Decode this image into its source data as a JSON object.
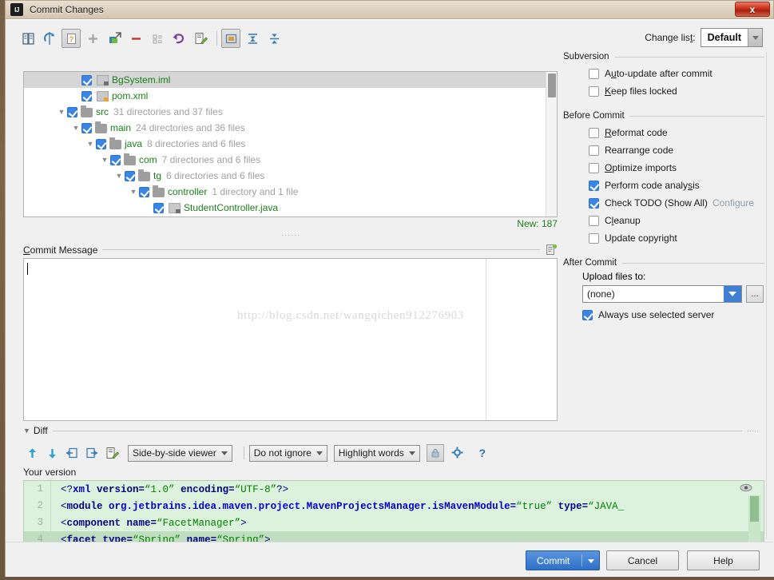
{
  "window": {
    "title": "Commit Changes",
    "logo_text": "IJ",
    "close_label": "x"
  },
  "toolbar": {
    "icons": [
      {
        "name": "show-diff-icon",
        "glyph": "⚒"
      },
      {
        "name": "refresh-icon",
        "glyph": "↻"
      },
      {
        "name": "show-unversioned-icon",
        "glyph": "?"
      },
      {
        "name": "add-icon",
        "glyph": "+"
      },
      {
        "name": "move-to-changelist-icon",
        "glyph": "↗"
      },
      {
        "name": "delete-icon",
        "glyph": "−"
      },
      {
        "name": "group-by-icon",
        "glyph": "☰"
      },
      {
        "name": "revert-icon",
        "glyph": "↶"
      },
      {
        "name": "edit-source-icon",
        "glyph": "✎"
      },
      {
        "name": "group-by-directory-icon",
        "glyph": "▣"
      },
      {
        "name": "expand-all-icon",
        "glyph": "⤓"
      },
      {
        "name": "collapse-all-icon",
        "glyph": "⤒"
      }
    ],
    "changelist_label_pre": "Change lis",
    "changelist_label_mnemonic": "t",
    "changelist_label_post": ":",
    "changelist_value": "Default"
  },
  "tree": {
    "rows": [
      {
        "indent": 3,
        "twisty": "",
        "checked": true,
        "icon": "file-iml",
        "name": "BgSystem.iml",
        "meta": "",
        "selected": true
      },
      {
        "indent": 3,
        "twisty": "",
        "checked": true,
        "icon": "file-xml",
        "name": "pom.xml",
        "meta": "",
        "selected": false
      },
      {
        "indent": 2,
        "twisty": "▼",
        "checked": true,
        "icon": "folder",
        "name": "src",
        "meta": "31 directories and 37 files",
        "selected": false
      },
      {
        "indent": 3,
        "twisty": "▼",
        "checked": true,
        "icon": "folder",
        "name": "main",
        "meta": "24 directories and 36 files",
        "selected": false
      },
      {
        "indent": 4,
        "twisty": "▼",
        "checked": true,
        "icon": "folder",
        "name": "java",
        "meta": "8 directories and 6 files",
        "selected": false
      },
      {
        "indent": 5,
        "twisty": "▼",
        "checked": true,
        "icon": "folder",
        "name": "com",
        "meta": "7 directories and 6 files",
        "selected": false
      },
      {
        "indent": 6,
        "twisty": "▼",
        "checked": true,
        "icon": "folder",
        "name": "tg",
        "meta": "6 directories and 6 files",
        "selected": false
      },
      {
        "indent": 7,
        "twisty": "▼",
        "checked": true,
        "icon": "folder",
        "name": "controller",
        "meta": "1 directory and 1 file",
        "selected": false
      },
      {
        "indent": 8,
        "twisty": "",
        "checked": true,
        "icon": "file-java",
        "name": "StudentController.java",
        "meta": "",
        "selected": false
      }
    ],
    "status": "New: 187"
  },
  "commit_message": {
    "label_mnemonic": "C",
    "label_rest": "ommit Message",
    "value": "",
    "history_icon": "commit-message-history-icon",
    "watermark": "http://blog.csdn.net/wangqichen912276903"
  },
  "options": {
    "groups": [
      {
        "title": "Subversion",
        "items": [
          {
            "label_pre": "A",
            "mnemonic": "u",
            "label_post": "to-update after commit",
            "checked": false,
            "name": "auto-update-after-commit"
          },
          {
            "label_pre": "",
            "mnemonic": "K",
            "label_post": "eep files locked",
            "checked": false,
            "name": "keep-files-locked"
          }
        ]
      },
      {
        "title": "Before Commit",
        "items": [
          {
            "label_pre": "",
            "mnemonic": "R",
            "label_post": "eformat code",
            "checked": false,
            "name": "reformat-code"
          },
          {
            "label_pre": "Rearran",
            "mnemonic": "g",
            "label_post": "e code",
            "checked": false,
            "name": "rearrange-code"
          },
          {
            "label_pre": "",
            "mnemonic": "O",
            "label_post": "ptimize imports",
            "checked": false,
            "name": "optimize-imports"
          },
          {
            "label_pre": "Perform code analy",
            "mnemonic": "s",
            "label_post": "is",
            "checked": true,
            "name": "perform-code-analysis"
          },
          {
            "label_pre": "Check TODO (Show All)",
            "mnemonic": "",
            "label_post": "",
            "checked": true,
            "name": "check-todo",
            "link": "Configure"
          },
          {
            "label_pre": "C",
            "mnemonic": "l",
            "label_post": "eanup",
            "checked": false,
            "name": "cleanup"
          },
          {
            "label_pre": "Update copyright",
            "mnemonic": "",
            "label_post": "",
            "checked": false,
            "name": "update-copyright"
          }
        ]
      },
      {
        "title": "After Commit",
        "items": []
      }
    ],
    "upload_label": "Upload files to:",
    "upload_value": "(none)",
    "upload_browse_label": "...",
    "always_use_selected_server": {
      "label": "Always use selected server",
      "checked": true
    }
  },
  "diff": {
    "section_title": "Diff",
    "toolbar": {
      "icons": [
        {
          "name": "previous-difference-icon",
          "glyph": "↑"
        },
        {
          "name": "next-difference-icon",
          "glyph": "↓"
        },
        {
          "name": "accept-left-icon",
          "glyph": "⇤"
        },
        {
          "name": "accept-right-icon",
          "glyph": "⇥"
        },
        {
          "name": "edit-source-icon",
          "glyph": "✎"
        }
      ],
      "viewer_mode": "Side-by-side viewer",
      "whitespace_mode": "Do not ignore",
      "highlight_mode": "Highlight words",
      "lock_icon": "lock-icon",
      "settings_icon": "gear-icon",
      "help_icon": "?"
    },
    "pane_label": "Your version",
    "lines": [
      {
        "num": "1",
        "highlight": false,
        "tokens": [
          {
            "t": "<?",
            "c": "c-punct"
          },
          {
            "t": "xml",
            "c": "c-name"
          },
          {
            "t": " version=",
            "c": "c-attr"
          },
          {
            "t": "“1.0”",
            "c": "c-val"
          },
          {
            "t": " encoding=",
            "c": "c-attr"
          },
          {
            "t": "“UTF-8”",
            "c": "c-val"
          },
          {
            "t": "?>",
            "c": "c-punct"
          }
        ]
      },
      {
        "num": "2",
        "highlight": false,
        "tokens": [
          {
            "t": "<",
            "c": "c-punct"
          },
          {
            "t": "module",
            "c": "c-tag"
          },
          {
            "t": " org.jetbrains.idea.maven.project.MavenProjectsManager.isMavenModule=",
            "c": "c-name"
          },
          {
            "t": "“true”",
            "c": "c-val"
          },
          {
            "t": " type=",
            "c": "c-attr"
          },
          {
            "t": "“JAVA_",
            "c": "c-val"
          }
        ]
      },
      {
        "num": "3",
        "highlight": false,
        "tokens": [
          {
            "t": "  <",
            "c": "c-punct"
          },
          {
            "t": "component",
            "c": "c-tag"
          },
          {
            "t": " name=",
            "c": "c-attr"
          },
          {
            "t": "“FacetManager”",
            "c": "c-val"
          },
          {
            "t": ">",
            "c": "c-punct"
          }
        ]
      },
      {
        "num": "4",
        "highlight": true,
        "tokens": [
          {
            "t": "    <",
            "c": "c-punct"
          },
          {
            "t": "facet",
            "c": "c-tag"
          },
          {
            "t": " type=",
            "c": "c-attr"
          },
          {
            "t": "“Spring”",
            "c": "c-val"
          },
          {
            "t": " name=",
            "c": "c-attr"
          },
          {
            "t": "“Spring”",
            "c": "c-val"
          },
          {
            "t": ">",
            "c": "c-punct"
          }
        ]
      }
    ]
  },
  "buttons": {
    "commit": "Commit",
    "cancel": "Cancel",
    "help": "Help"
  },
  "colors": {
    "accent_blue": "#3a86e8",
    "node_green": "#1a7f1a",
    "diff_bg": "#ddf2dd",
    "diff_hl": "#bfddbf",
    "close_red": "#cf3a22"
  }
}
